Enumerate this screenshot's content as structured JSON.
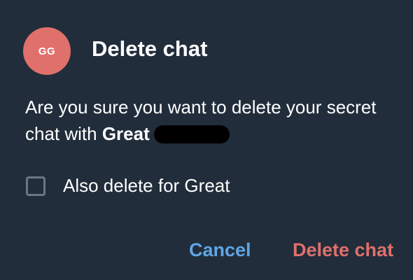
{
  "dialog": {
    "avatar_initials": "GG",
    "title": "Delete chat",
    "message_prefix": "Are you sure you want to delete your secret chat with ",
    "contact_name_visible": "Great",
    "option_label": "Also delete for Great",
    "option_checked": false,
    "cancel_label": "Cancel",
    "delete_label": "Delete chat"
  },
  "colors": {
    "background": "#212d3b",
    "avatar": "#e0706b",
    "cancel": "#5fa6e4",
    "destructive": "#e0706b",
    "checkbox_border": "#6b7785"
  }
}
